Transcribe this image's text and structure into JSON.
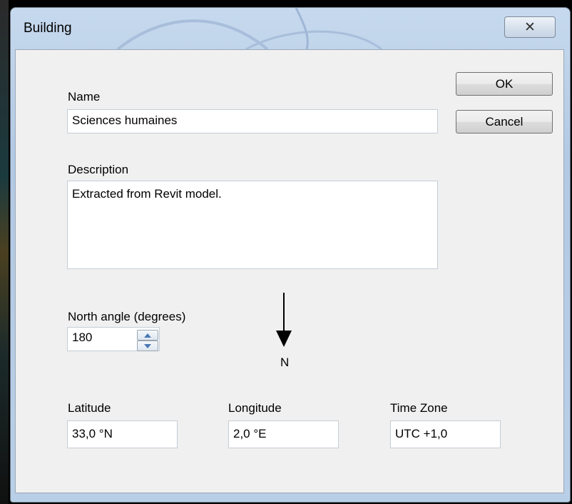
{
  "window": {
    "title": "Building",
    "close_glyph": "✕"
  },
  "buttons": {
    "ok": "OK",
    "cancel": "Cancel"
  },
  "name": {
    "label": "Name",
    "value": "Sciences humaines"
  },
  "description": {
    "label": "Description",
    "value": "Extracted from Revit model."
  },
  "north_angle": {
    "label": "North angle (degrees)",
    "value": "180",
    "compass_letter": "N"
  },
  "latitude": {
    "label": "Latitude",
    "value": "33,0 °N"
  },
  "longitude": {
    "label": "Longitude",
    "value": "2,0 °E"
  },
  "time_zone": {
    "label": "Time Zone",
    "value": "UTC +1,0"
  },
  "colors": {
    "titlebar": "#b9cfe7",
    "client_background": "#f0f0f0",
    "spin_arrow": "#4a78b5"
  },
  "icons": {
    "close": "close-icon",
    "spin_up": "spin-up-icon",
    "spin_down": "spin-down-icon",
    "north_arrow": "north-arrow-icon"
  }
}
